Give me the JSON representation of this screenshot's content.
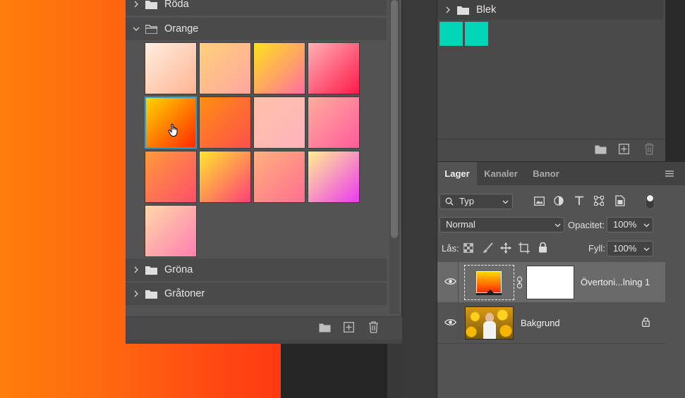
{
  "gradients_panel": {
    "groups": [
      {
        "name": "Röda",
        "expanded": false
      },
      {
        "name": "Orange",
        "expanded": true
      },
      {
        "name": "Gröna",
        "expanded": false
      },
      {
        "name": "Gråtoner",
        "expanded": false
      }
    ],
    "orange_swatches": [
      {
        "from": "#ffeee0",
        "to": "#ffb491"
      },
      {
        "from": "#ffd07a",
        "to": "#ffa6a0"
      },
      {
        "from": "#ffe31a",
        "to": "#ff6f9f"
      },
      {
        "from": "#ffb0b5",
        "to": "#ff1a4a"
      },
      {
        "from": "#ffd400",
        "to": "#ff2a00"
      },
      {
        "from": "#ff8f10",
        "to": "#ff4f4f"
      },
      {
        "from": "#ffc1a7",
        "to": "#ffb3bd"
      },
      {
        "from": "#ffad9c",
        "to": "#ff5b9b"
      },
      {
        "from": "#ff9a3a",
        "to": "#ff4f6b"
      },
      {
        "from": "#ffe62b",
        "to": "#ff3e78"
      },
      {
        "from": "#ffb07d",
        "to": "#ff6f8f"
      },
      {
        "from": "#ffef8f",
        "to": "#ee3af0"
      },
      {
        "from": "#ffd7a8",
        "to": "#ff7fb0"
      }
    ],
    "selected_index": 4
  },
  "swatches_panel": {
    "group": "Blek",
    "colors": [
      "#00d6b8",
      "#00d6b8"
    ]
  },
  "layers_panel": {
    "tabs": [
      "Lager",
      "Kanaler",
      "Banor"
    ],
    "active_tab": "Lager",
    "filter_kind": "Typ",
    "blend_mode": "Normal",
    "opacity_label": "Opacitet:",
    "opacity_value": "100%",
    "lock_label": "Lås:",
    "fill_label": "Fyll:",
    "fill_value": "100%",
    "layers": [
      {
        "name": "Övertoni...lning 1",
        "selected": true
      },
      {
        "name": "Bakgrund",
        "selected": false,
        "locked": true
      }
    ]
  },
  "colors": {
    "selection_border": "#2fa2c8",
    "panel_bg": "#535353",
    "canvas_left": "#ff7d0a",
    "canvas_right": "#ff3912"
  }
}
